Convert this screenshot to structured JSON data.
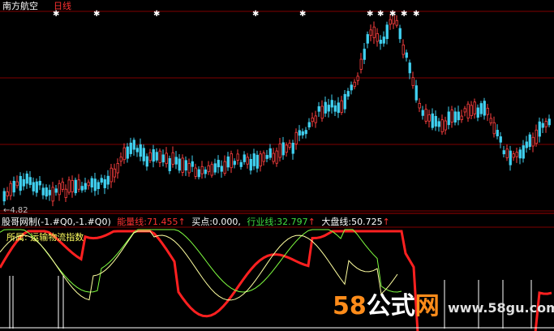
{
  "header": {
    "stock_name": "南方航空",
    "period": "日线",
    "price_low_marker": "←4.82"
  },
  "indicator": {
    "name": "股哥网制",
    "params": "(-1.#Q0,-1.#Q0)",
    "lines": [
      {
        "label": "能量线:",
        "value": "71.455",
        "arrow": "↑",
        "color": "#ff3030"
      },
      {
        "label": "买点:",
        "value": "0.000,",
        "arrow": "",
        "color": "#ffffff"
      },
      {
        "label": "行业线:",
        "value": "32.797",
        "arrow": "↑",
        "color": "#3fdc3f"
      },
      {
        "label": "大盘线:",
        "value": "50.725",
        "arrow": "↑",
        "color": "#ffffff"
      }
    ],
    "sector_label": "所属:",
    "sector_value": "运输物流指数"
  },
  "watermark": {
    "num": "58",
    "gs": "公式",
    "wang": "网",
    "url": "www.58gu.com"
  },
  "colors": {
    "up": "#ff4040",
    "down": "#40d0f0",
    "energy": "#ff2020",
    "industry": "#80ff40",
    "market": "#ffffa0",
    "grid": "#800000"
  }
}
